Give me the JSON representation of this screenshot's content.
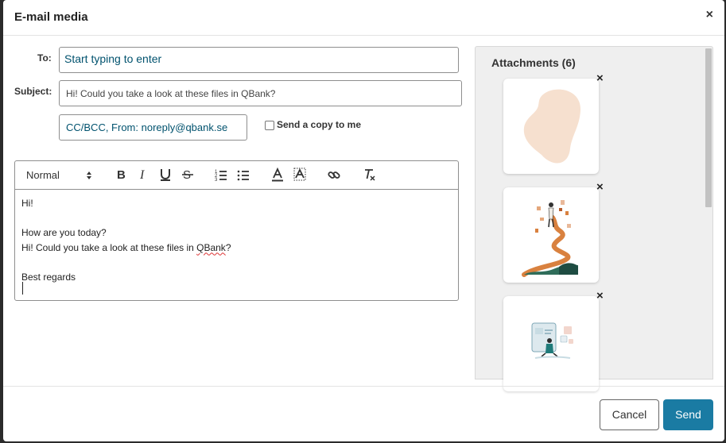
{
  "dialog": {
    "title": "E-mail media",
    "close_glyph": "×"
  },
  "form": {
    "to_label": "To:",
    "to_placeholder": "Start typing to enter",
    "subject_label": "Subject:",
    "subject_value": "Hi! Could you take a look at these files in QBank?",
    "cc_text": "CC/BCC, From: noreply@qbank.se",
    "copy_label": "Send a copy to me",
    "copy_checked": false
  },
  "editor": {
    "format_value": "Normal",
    "toolbar_icons": [
      "bold-icon",
      "italic-icon",
      "underline-icon",
      "strikethrough-icon",
      "ordered-list-icon",
      "bullet-list-icon",
      "text-color-icon",
      "highlight-icon",
      "link-icon",
      "clear-format-icon"
    ],
    "body": {
      "line1": "Hi!",
      "line2": "How are you today?",
      "line3_pre": "Hi! Could you take a look at these files in ",
      "line3_word": "QBank",
      "line3_post": "?",
      "line4": "Best regards"
    }
  },
  "attachments": {
    "title": "Attachments (6)",
    "remove_glyph": "×",
    "items": [
      {
        "icon": "abstract-shape-thumbnail"
      },
      {
        "icon": "woman-walking-path-thumbnail"
      },
      {
        "icon": "person-at-screen-thumbnail"
      }
    ]
  },
  "footer": {
    "cancel_label": "Cancel",
    "send_label": "Send"
  },
  "colors": {
    "accent": "#1a7ba3",
    "link_text": "#00526e",
    "panel_bg": "#efefef"
  }
}
